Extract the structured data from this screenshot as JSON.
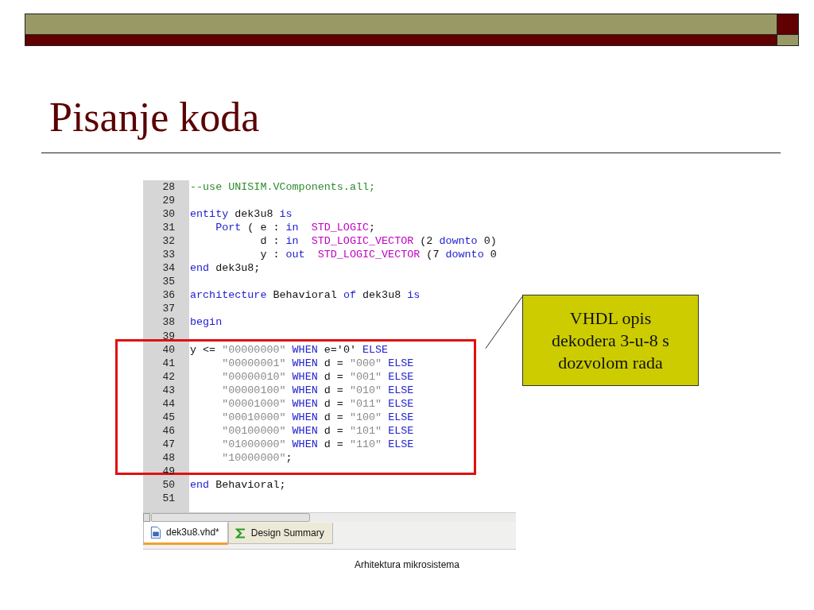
{
  "slide": {
    "title": "Pisanje koda",
    "footer": "Arhitektura mikrosistema"
  },
  "editor": {
    "lines": [
      {
        "number": "28",
        "tokens": [
          {
            "kind": "comment",
            "text": "--use UNISIM.VComponents.all;"
          }
        ]
      },
      {
        "number": "29"
      },
      {
        "number": "30",
        "tokens": [
          {
            "kind": "keyword",
            "text": "entity"
          },
          {
            "kind": "plain",
            "text": " dek3u8 "
          },
          {
            "kind": "keyword",
            "text": "is"
          }
        ]
      },
      {
        "number": "31",
        "tokens": [
          {
            "kind": "keyword",
            "text": "    Port"
          },
          {
            "kind": "plain",
            "text": " ( e : "
          },
          {
            "kind": "keyword",
            "text": "in"
          },
          {
            "kind": "type",
            "text": "  STD_LOGIC"
          },
          {
            "kind": "plain",
            "text": ";"
          }
        ]
      },
      {
        "number": "32",
        "tokens": [
          {
            "kind": "plain",
            "text": "           d : "
          },
          {
            "kind": "keyword",
            "text": "in"
          },
          {
            "kind": "type",
            "text": "  STD_LOGIC_VECTOR"
          },
          {
            "kind": "plain",
            "text": " (2 "
          },
          {
            "kind": "keyword",
            "text": "downto"
          },
          {
            "kind": "plain",
            "text": " 0)"
          }
        ]
      },
      {
        "number": "33",
        "tokens": [
          {
            "kind": "plain",
            "text": "           y : "
          },
          {
            "kind": "keyword",
            "text": "out"
          },
          {
            "kind": "type",
            "text": "  STD_LOGIC_VECTOR"
          },
          {
            "kind": "plain",
            "text": " (7 "
          },
          {
            "kind": "keyword",
            "text": "downto"
          },
          {
            "kind": "plain",
            "text": " 0"
          }
        ]
      },
      {
        "number": "34",
        "tokens": [
          {
            "kind": "keyword",
            "text": "end"
          },
          {
            "kind": "plain",
            "text": " dek3u8;"
          }
        ]
      },
      {
        "number": "35"
      },
      {
        "number": "36",
        "tokens": [
          {
            "kind": "keyword",
            "text": "architecture"
          },
          {
            "kind": "plain",
            "text": " Behavioral "
          },
          {
            "kind": "keyword",
            "text": "of"
          },
          {
            "kind": "plain",
            "text": " dek3u8 "
          },
          {
            "kind": "keyword",
            "text": "is"
          }
        ]
      },
      {
        "number": "37"
      },
      {
        "number": "38",
        "tokens": [
          {
            "kind": "keyword",
            "text": "begin"
          }
        ]
      },
      {
        "number": "39"
      },
      {
        "number": "40",
        "tokens": [
          {
            "kind": "plain",
            "text": "y <= "
          },
          {
            "kind": "string",
            "text": "\"00000000\""
          },
          {
            "kind": "keyword",
            "text": " WHEN"
          },
          {
            "kind": "plain",
            "text": " e='0' "
          },
          {
            "kind": "keyword",
            "text": "ELSE"
          }
        ]
      },
      {
        "number": "41",
        "tokens": [
          {
            "kind": "string",
            "text": "     \"00000001\""
          },
          {
            "kind": "keyword",
            "text": " WHEN"
          },
          {
            "kind": "plain",
            "text": " d = "
          },
          {
            "kind": "string",
            "text": "\"000\""
          },
          {
            "kind": "keyword",
            "text": " ELSE"
          }
        ]
      },
      {
        "number": "42",
        "tokens": [
          {
            "kind": "string",
            "text": "     \"00000010\""
          },
          {
            "kind": "keyword",
            "text": " WHEN"
          },
          {
            "kind": "plain",
            "text": " d = "
          },
          {
            "kind": "string",
            "text": "\"001\""
          },
          {
            "kind": "keyword",
            "text": " ELSE"
          }
        ]
      },
      {
        "number": "43",
        "tokens": [
          {
            "kind": "string",
            "text": "     \"00000100\""
          },
          {
            "kind": "keyword",
            "text": " WHEN"
          },
          {
            "kind": "plain",
            "text": " d = "
          },
          {
            "kind": "string",
            "text": "\"010\""
          },
          {
            "kind": "keyword",
            "text": " ELSE"
          }
        ]
      },
      {
        "number": "44",
        "tokens": [
          {
            "kind": "string",
            "text": "     \"00001000\""
          },
          {
            "kind": "keyword",
            "text": " WHEN"
          },
          {
            "kind": "plain",
            "text": " d = "
          },
          {
            "kind": "string",
            "text": "\"011\""
          },
          {
            "kind": "keyword",
            "text": " ELSE"
          }
        ]
      },
      {
        "number": "45",
        "tokens": [
          {
            "kind": "string",
            "text": "     \"00010000\""
          },
          {
            "kind": "keyword",
            "text": " WHEN"
          },
          {
            "kind": "plain",
            "text": " d = "
          },
          {
            "kind": "string",
            "text": "\"100\""
          },
          {
            "kind": "keyword",
            "text": " ELSE"
          }
        ]
      },
      {
        "number": "46",
        "tokens": [
          {
            "kind": "string",
            "text": "     \"00100000\""
          },
          {
            "kind": "keyword",
            "text": " WHEN"
          },
          {
            "kind": "plain",
            "text": " d = "
          },
          {
            "kind": "string",
            "text": "\"101\""
          },
          {
            "kind": "keyword",
            "text": " ELSE"
          }
        ]
      },
      {
        "number": "47",
        "tokens": [
          {
            "kind": "string",
            "text": "     \"01000000\""
          },
          {
            "kind": "keyword",
            "text": " WHEN"
          },
          {
            "kind": "plain",
            "text": " d = "
          },
          {
            "kind": "string",
            "text": "\"110\""
          },
          {
            "kind": "keyword",
            "text": " ELSE"
          }
        ]
      },
      {
        "number": "48",
        "tokens": [
          {
            "kind": "string",
            "text": "     \"10000000\""
          },
          {
            "kind": "plain",
            "text": ";"
          }
        ]
      },
      {
        "number": "49"
      },
      {
        "number": "50",
        "tokens": [
          {
            "kind": "keyword",
            "text": "end"
          },
          {
            "kind": "plain",
            "text": " Behavioral;"
          }
        ]
      },
      {
        "number": "51"
      }
    ],
    "tabs": [
      {
        "label": "dek3u8.vhd*",
        "selected": true,
        "kind": "file"
      },
      {
        "label": "Design Summary",
        "selected": false,
        "kind": "summary"
      }
    ]
  },
  "callout": {
    "text": "VHDL opis dekodera 3-u-8 s dozvolom rada"
  }
}
